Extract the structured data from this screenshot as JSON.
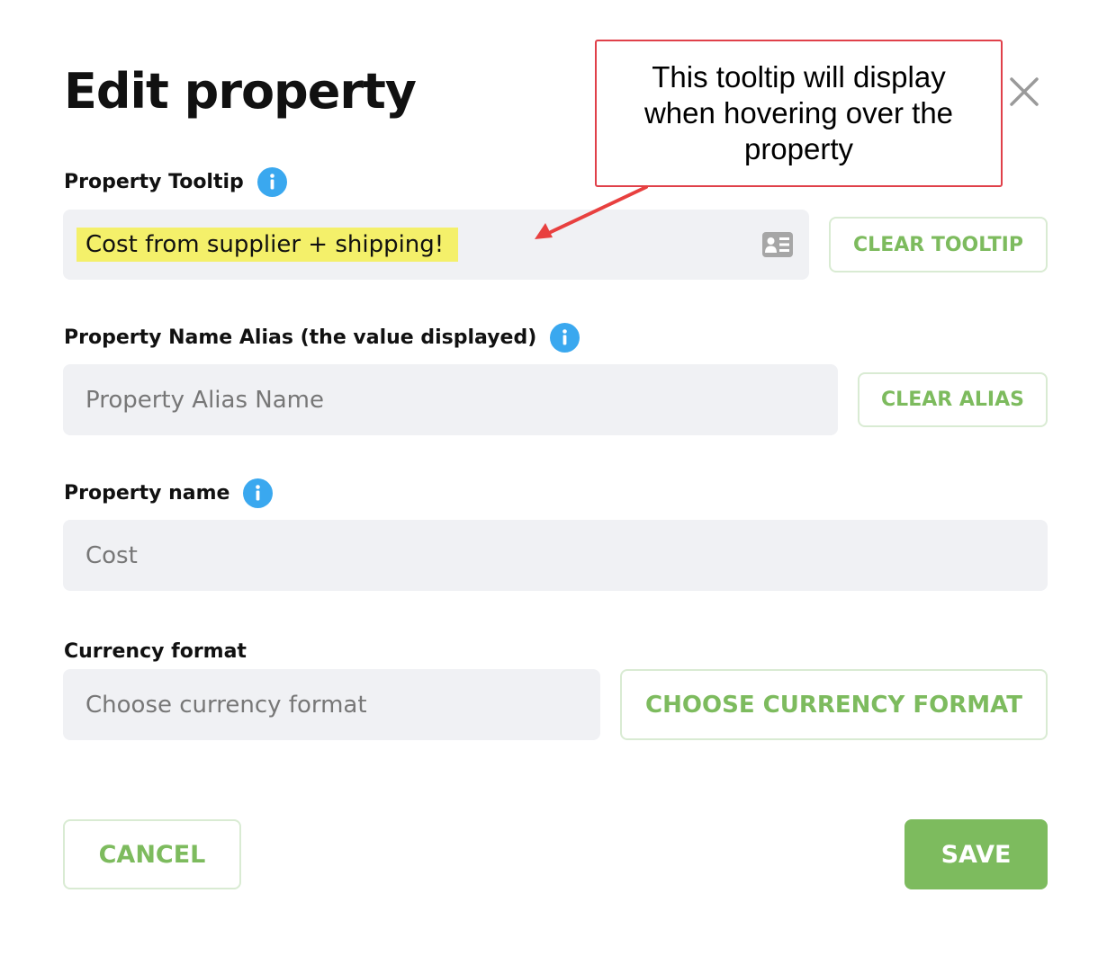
{
  "dialog": {
    "title": "Edit property",
    "close_icon": "close-icon"
  },
  "callout": {
    "text": "This tooltip will display when hovering over the property",
    "color": "#e0404a"
  },
  "tooltip_section": {
    "label": "Property Tooltip",
    "value": "Cost from supplier + shipping!",
    "field_icon": "contact-card-icon",
    "clear_label": "CLEAR TOOLTIP"
  },
  "alias_section": {
    "label": "Property Name Alias (the value displayed)",
    "placeholder": "Property Alias Name",
    "clear_label": "CLEAR ALIAS"
  },
  "name_section": {
    "label": "Property name",
    "value": "Cost"
  },
  "currency_section": {
    "label": "Currency format",
    "placeholder": "Choose currency format",
    "choose_label": "CHOOSE CURRENCY FORMAT"
  },
  "footer": {
    "cancel_label": "CANCEL",
    "save_label": "SAVE"
  },
  "colors": {
    "accent_green": "#7dbb5e",
    "info_blue": "#3aa8ef",
    "field_bg": "#f0f1f4",
    "highlight_yellow": "#f4f06a"
  }
}
